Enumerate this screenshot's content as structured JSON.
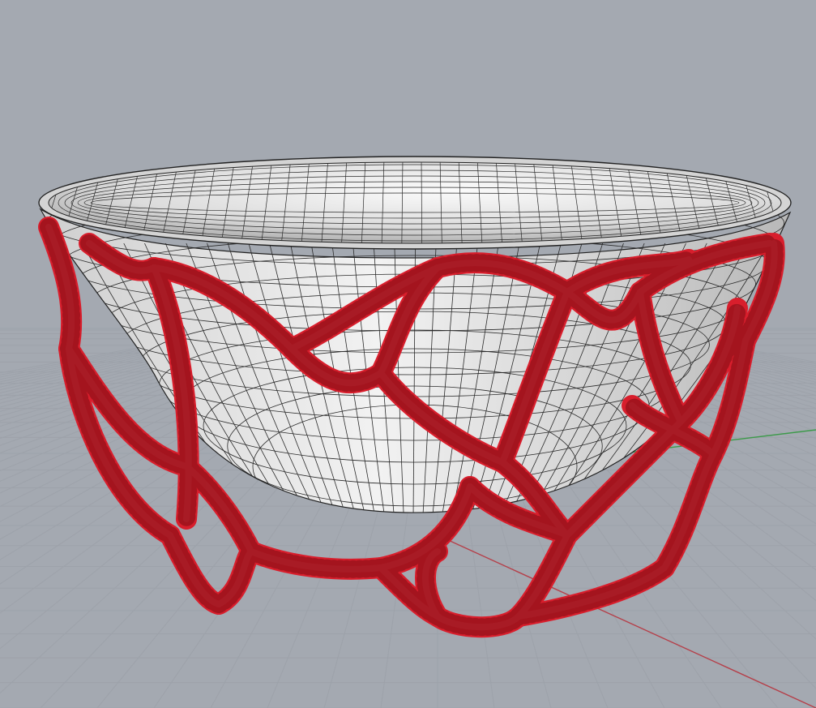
{
  "viewport": {
    "background_color": "#a4a9b1",
    "grid_minor_color": "#9da2aa",
    "grid_major_color": "#8e939b",
    "x_axis_color": "#b5404a",
    "y_axis_color": "#3d9a4a"
  },
  "objects": [
    {
      "kind": "bowl-surface",
      "color": "#e6e6e6",
      "wire_color": "#1a1a1a"
    },
    {
      "kind": "voronoi-stand",
      "color": "#d81e2c",
      "wire_color": "#7a0d14"
    }
  ]
}
